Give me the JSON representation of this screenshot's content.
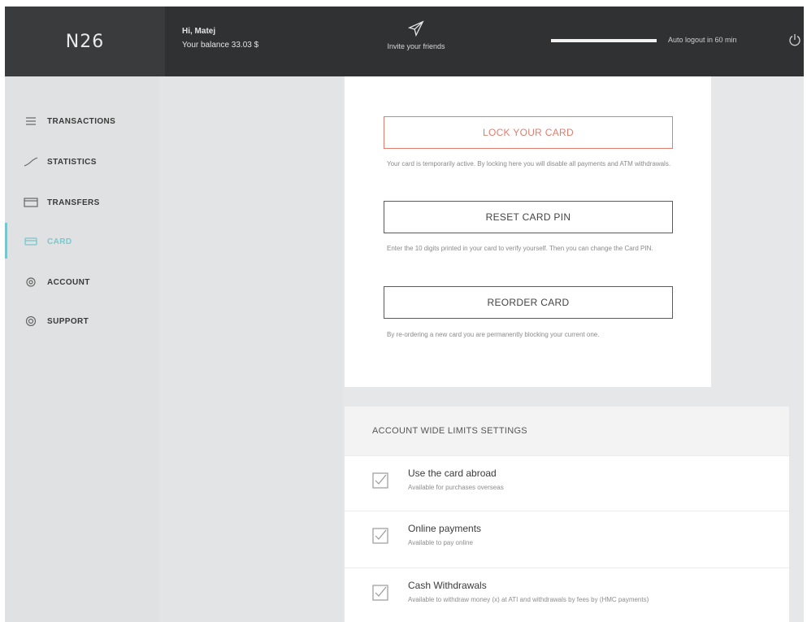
{
  "header": {
    "logo": "N26",
    "greeting": "Hi, Matej",
    "balance": "Your balance 33.03 $",
    "invite_label": "Invite your friends",
    "autologout_text": "Auto logout in 60 min",
    "autologout_progress": 1.0
  },
  "sidebar": {
    "items": [
      {
        "label": "TRANSACTIONS",
        "icon": "list-icon",
        "active": false
      },
      {
        "label": "STATISTICS",
        "icon": "chart-line-icon",
        "active": false
      },
      {
        "label": "TRANSFERS",
        "icon": "transfer-icon",
        "active": false
      },
      {
        "label": "CARD",
        "icon": "card-icon",
        "active": true
      },
      {
        "label": "ACCOUNT",
        "icon": "gear-icon",
        "active": false
      },
      {
        "label": "SUPPORT",
        "icon": "support-icon",
        "active": false
      }
    ]
  },
  "card_settings": {
    "lock_label": "LOCK YOUR CARD",
    "lock_desc": "Your card is temporarily active. By locking here you will disable all payments and ATM withdrawals.",
    "reset_label": "RESET CARD PIN",
    "reset_desc": "Enter the 10 digits printed in your card to verify yourself. Then you can change the Card PIN.",
    "reorder_label": "REORDER CARD",
    "reorder_desc": "By re-ordering a new card you are permanently blocking your current one."
  },
  "limits": {
    "heading": "ACCOUNT WIDE LIMITS SETTINGS",
    "rows": [
      {
        "title": "Use the card abroad",
        "sub": "Available for purchases overseas",
        "checked": true
      },
      {
        "title": "Online payments",
        "sub": "Available to pay online",
        "checked": true
      },
      {
        "title": "Cash Withdrawals",
        "sub": "Available to withdraw money (x) at ATI and withdrawals by fees by (HMC payments)",
        "checked": true
      }
    ]
  },
  "colors": {
    "accent": "#79c6cf",
    "lock": "#e07d6f",
    "header_bg": "#2f3132"
  }
}
